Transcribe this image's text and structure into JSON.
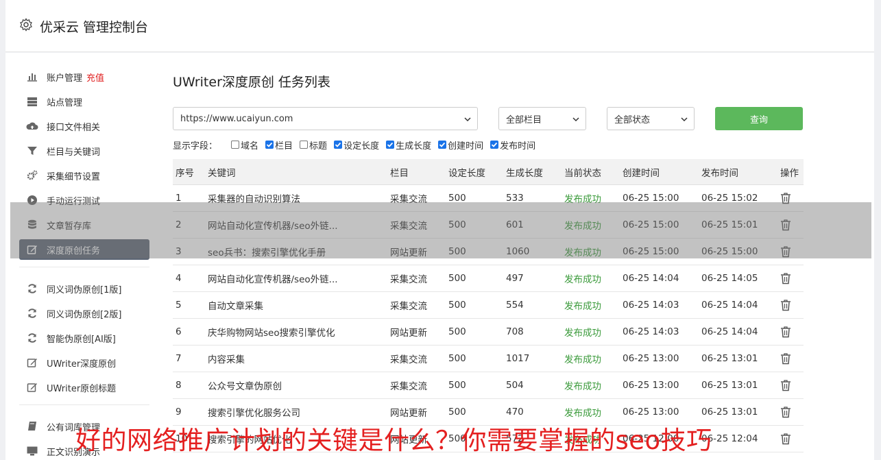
{
  "header": {
    "title": "优采云 管理控制台"
  },
  "sidebar": {
    "items": [
      {
        "label": "账户管理",
        "extra": "充值",
        "icon": "bar-chart-icon"
      },
      {
        "label": "站点管理",
        "icon": "server-icon"
      },
      {
        "label": "接口文件相关",
        "icon": "cloud-upload-icon"
      },
      {
        "label": "栏目与关键词",
        "icon": "filter-icon"
      },
      {
        "label": "采集细节设置",
        "icon": "cogs-icon"
      },
      {
        "label": "手动运行测试",
        "icon": "play-circle-icon"
      },
      {
        "label": "文章暂存库",
        "icon": "database-icon"
      },
      {
        "label": "深度原创任务",
        "icon": "edit-icon",
        "active": true
      }
    ],
    "items2": [
      {
        "label": "同义词伪原创[1版]",
        "icon": "refresh-icon"
      },
      {
        "label": "同义词伪原创[2版]",
        "icon": "refresh-icon"
      },
      {
        "label": "智能伪原创[AI版]",
        "icon": "refresh-icon"
      },
      {
        "label": "UWriter深度原创",
        "icon": "edit-icon"
      },
      {
        "label": "UWriter原创标题",
        "icon": "edit-icon"
      }
    ],
    "items3": [
      {
        "label": "公有词库管理",
        "icon": "book-icon"
      },
      {
        "label": "正文识别演示",
        "icon": "monitor-icon"
      }
    ]
  },
  "main": {
    "title": "UWriter深度原创 任务列表",
    "filters": {
      "site": "https://www.ucaiyun.com",
      "column": "全部栏目",
      "status": "全部状态",
      "query_label": "查询"
    },
    "fields_label": "显示字段：",
    "fields": [
      {
        "label": "域名",
        "checked": false
      },
      {
        "label": "栏目",
        "checked": true
      },
      {
        "label": "标题",
        "checked": false
      },
      {
        "label": "设定长度",
        "checked": true
      },
      {
        "label": "生成长度",
        "checked": true
      },
      {
        "label": "创建时间",
        "checked": true
      },
      {
        "label": "发布时间",
        "checked": true
      }
    ],
    "columns": [
      "序号",
      "关键词",
      "栏目",
      "设定长度",
      "生成长度",
      "当前状态",
      "创建时间",
      "发布时间",
      "操作"
    ],
    "rows": [
      [
        "1",
        "采集器的自动识别算法",
        "采集交流",
        "500",
        "533",
        "发布成功",
        "06-25 15:00",
        "06-25 15:02"
      ],
      [
        "2",
        "网站自动化宣传机器/seo外链...",
        "采集交流",
        "500",
        "601",
        "发布成功",
        "06-25 15:00",
        "06-25 15:01"
      ],
      [
        "3",
        "seo兵书：搜索引擎优化手册",
        "网站更新",
        "500",
        "1060",
        "发布成功",
        "06-25 15:00",
        "06-25 15:00"
      ],
      [
        "4",
        "网站自动化宣传机器/seo外链...",
        "采集交流",
        "500",
        "497",
        "发布成功",
        "06-25 14:04",
        "06-25 14:05"
      ],
      [
        "5",
        "自动文章采集",
        "采集交流",
        "500",
        "554",
        "发布成功",
        "06-25 14:03",
        "06-25 14:04"
      ],
      [
        "6",
        "庆华购物网站seo搜索引擎优化",
        "网站更新",
        "500",
        "708",
        "发布成功",
        "06-25 14:03",
        "06-25 14:04"
      ],
      [
        "7",
        "内容采集",
        "采集交流",
        "500",
        "1017",
        "发布成功",
        "06-25 13:00",
        "06-25 13:01"
      ],
      [
        "8",
        "公众号文章伪原创",
        "采集交流",
        "500",
        "504",
        "发布成功",
        "06-25 13:00",
        "06-25 13:01"
      ],
      [
        "9",
        "搜索引擎优化服务公司",
        "网站更新",
        "500",
        "470",
        "发布成功",
        "06-25 13:00",
        "06-25 13:01"
      ],
      [
        "10",
        "搜索引擎的网站优化",
        "网站更新",
        "500",
        "572",
        "发布成功",
        "06-25 12:00",
        "06-25 12:04"
      ]
    ]
  },
  "watermark": "好的网络推广计划的关键是什么？你需要掌握的seo技巧",
  "colors": {
    "accent_green": "#5cb85c",
    "active_bg": "#5b6574",
    "success": "#3a9a3a",
    "watermark": "#e42020"
  }
}
